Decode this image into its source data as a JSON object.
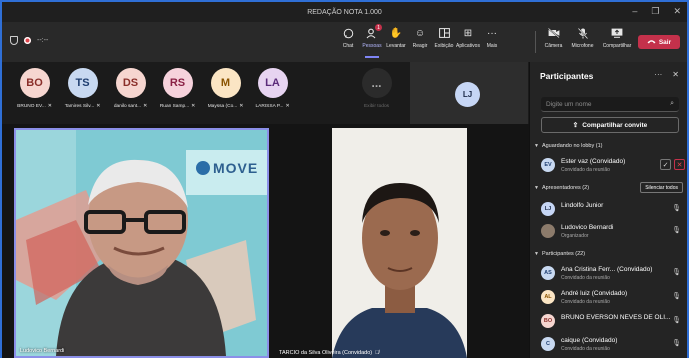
{
  "window": {
    "title": "REDAÇÃO NOTA 1.000"
  },
  "toolbar": {
    "timer": "--:--",
    "chat": "Chat",
    "people": "Pessoas",
    "people_badge": "1",
    "raise": "Levantar",
    "react": "Reagir",
    "view": "Exibição",
    "apps": "Aplicativos",
    "more": "Mais",
    "camera": "Câmera",
    "mic": "Microfone",
    "share": "Compartilhar",
    "leave": "Sair"
  },
  "strip": [
    {
      "initials": "BO",
      "name": "BRUNO EV...",
      "bg": "#f6d6d0",
      "fg": "#8a2f2a"
    },
    {
      "initials": "TS",
      "name": "Tamires Silv...",
      "bg": "#c8d9f1",
      "fg": "#1e3e70"
    },
    {
      "initials": "DS",
      "name": "danilo sant...",
      "bg": "#f6d6d0",
      "fg": "#8a2f2a"
    },
    {
      "initials": "RS",
      "name": "Ruan Samp...",
      "bg": "#f6d2dc",
      "fg": "#8a2045"
    },
    {
      "initials": "M",
      "name": "Mayssa (Co...",
      "bg": "#fbe5c4",
      "fg": "#8a5300"
    },
    {
      "initials": "LA",
      "name": "LARISSA P...",
      "bg": "#e7d4f1",
      "fg": "#5b2b7a"
    }
  ],
  "strip_more": {
    "label": "Exibir todos",
    "icon": "..."
  },
  "lj_tile": {
    "initials": "LJ"
  },
  "videos": {
    "main_name": "Ludovico Bernardi",
    "second_name": "TARCIO da Silva Oliveira (Convidado)",
    "logo_text": "MOVE"
  },
  "panel": {
    "title": "Participantes",
    "search_placeholder": "Digite um nome",
    "share_invite": "Compartilhar convite",
    "lobby_header": "Aguardando no lobby (1)",
    "presenters_header": "Apresentadores (2)",
    "mute_all": "Silenciar todos",
    "participants_header": "Participantes (22)",
    "lobby": [
      {
        "initials": "EV",
        "name": "Ester vaz (Convidado)",
        "sub": "Convidado da reunião",
        "bg": "#c8d9f1",
        "fg": "#1e3e70"
      }
    ],
    "presenters": [
      {
        "initials": "LJ",
        "name": "Lindolfo Junior",
        "sub": "",
        "bg": "#c6d6f5",
        "fg": "#1b2a48"
      },
      {
        "initials": "",
        "name": "Ludovico Bernardi",
        "sub": "Organizador",
        "bg": "#8c7b6b",
        "fg": "#fff"
      }
    ],
    "participants": [
      {
        "initials": "AS",
        "name": "Ana Cristina Ferr... (Convidado)",
        "sub": "Convidado da reunião",
        "bg": "#c8d9f1",
        "fg": "#1e3e70"
      },
      {
        "initials": "AL",
        "name": "André luiz (Convidado)",
        "sub": "Convidado da reunião",
        "bg": "#fbe5c4",
        "fg": "#8a5300"
      },
      {
        "initials": "BO",
        "name": "BRUNO EVERSON NEVES DE OLI...",
        "sub": "",
        "bg": "#f6d6d0",
        "fg": "#8a2f2a"
      },
      {
        "initials": "C",
        "name": "caique (Convidado)",
        "sub": "Convidado da reunião",
        "bg": "#c8d9f1",
        "fg": "#1e3e70"
      }
    ]
  },
  "colors": {
    "accent": "#7f85f5",
    "leave": "#c4314b",
    "frame": "#2f6fd6"
  }
}
